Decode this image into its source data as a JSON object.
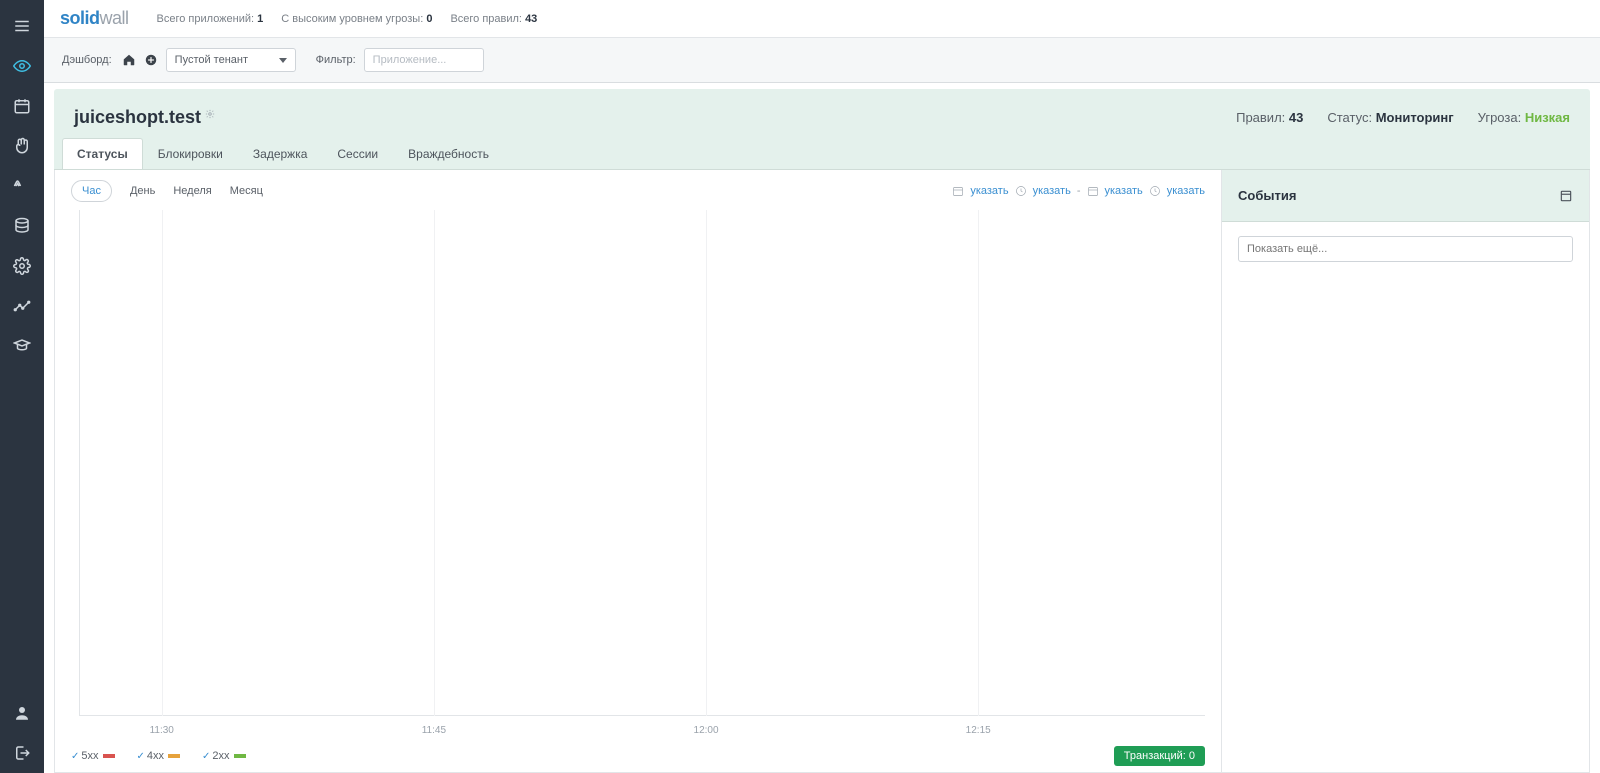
{
  "logo": {
    "part1": "solid",
    "part2": "wall"
  },
  "topstats": {
    "apps_label": "Всего приложений:",
    "apps_value": "1",
    "high_label": "С высоким уровнем угрозы:",
    "high_value": "0",
    "rules_label": "Всего правил:",
    "rules_value": "43"
  },
  "dash": {
    "label": "Дэшборд:",
    "tenant": "Пустой тенант",
    "filter_label": "Фильтр:",
    "filter_placeholder": "Приложение..."
  },
  "app": {
    "title": "juiceshopt.test",
    "rules_label": "Правил:",
    "rules_value": "43",
    "status_label": "Статус:",
    "status_value": "Мониторинг",
    "threat_label": "Угроза:",
    "threat_value": "Низкая"
  },
  "tabs": {
    "statuses": "Статусы",
    "blocks": "Блокировки",
    "delay": "Задержка",
    "sessions": "Сессии",
    "hostility": "Враждебность"
  },
  "range": {
    "hour": "Час",
    "day": "День",
    "week": "Неделя",
    "month": "Месяц"
  },
  "datelinks": {
    "set": "указать",
    "dash": "-"
  },
  "legend": {
    "s5": "5xx",
    "s4": "4xx",
    "s2": "2xx"
  },
  "transactions": {
    "label": "Транзакций:",
    "value": "0"
  },
  "events": {
    "title": "События",
    "more_placeholder": "Показать ещё..."
  },
  "chart_data": {
    "type": "line",
    "x": [
      "11:30",
      "11:45",
      "12:00",
      "12:15"
    ],
    "series": [
      {
        "name": "5xx",
        "values": [
          0,
          0,
          0,
          0
        ]
      },
      {
        "name": "4xx",
        "values": [
          0,
          0,
          0,
          0
        ]
      },
      {
        "name": "2xx",
        "values": [
          0,
          0,
          0,
          0
        ]
      }
    ],
    "title": "",
    "xlabel": "",
    "ylabel": "",
    "ylim": [
      0,
      1
    ]
  }
}
